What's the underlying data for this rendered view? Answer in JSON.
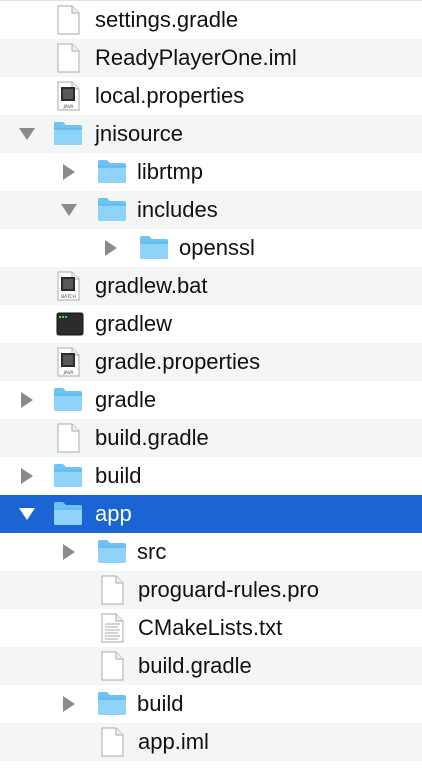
{
  "tree": [
    {
      "label": "settings.gradle",
      "depth": 1,
      "type": "doc",
      "disclosure": "none"
    },
    {
      "label": "ReadyPlayerOne.iml",
      "depth": 1,
      "type": "doc",
      "disclosure": "none"
    },
    {
      "label": "local.properties",
      "depth": 1,
      "type": "java",
      "disclosure": "none",
      "badge": "JAVA"
    },
    {
      "label": "jnisource",
      "depth": 0,
      "type": "folder",
      "disclosure": "expanded"
    },
    {
      "label": "librtmp",
      "depth": 1,
      "type": "folder",
      "disclosure": "collapsed"
    },
    {
      "label": "includes",
      "depth": 1,
      "type": "folder",
      "disclosure": "expanded"
    },
    {
      "label": "openssl",
      "depth": 2,
      "type": "folder",
      "disclosure": "collapsed"
    },
    {
      "label": "gradlew.bat",
      "depth": 1,
      "type": "batch",
      "disclosure": "none",
      "badge": "BATCH"
    },
    {
      "label": "gradlew",
      "depth": 1,
      "type": "terminal",
      "disclosure": "none",
      "badge": "exec"
    },
    {
      "label": "gradle.properties",
      "depth": 1,
      "type": "java",
      "disclosure": "none",
      "badge": "JAVA"
    },
    {
      "label": "gradle",
      "depth": 0,
      "type": "folder",
      "disclosure": "collapsed"
    },
    {
      "label": "build.gradle",
      "depth": 1,
      "type": "doc",
      "disclosure": "none"
    },
    {
      "label": "build",
      "depth": 0,
      "type": "folder",
      "disclosure": "collapsed"
    },
    {
      "label": "app",
      "depth": 0,
      "type": "folder",
      "disclosure": "expanded",
      "selected": true
    },
    {
      "label": "src",
      "depth": 1,
      "type": "folder",
      "disclosure": "collapsed"
    },
    {
      "label": "proguard-rules.pro",
      "depth": 2,
      "type": "doc",
      "disclosure": "none"
    },
    {
      "label": "CMakeLists.txt",
      "depth": 2,
      "type": "text",
      "disclosure": "none"
    },
    {
      "label": "build.gradle",
      "depth": 2,
      "type": "doc",
      "disclosure": "none"
    },
    {
      "label": "build",
      "depth": 1,
      "type": "folder",
      "disclosure": "collapsed"
    },
    {
      "label": "app.iml",
      "depth": 2,
      "type": "doc",
      "disclosure": "none"
    }
  ],
  "colors": {
    "selection": "#1a64d3",
    "folder": "#6dc3f3",
    "alt_row": "#f4f5f5"
  }
}
